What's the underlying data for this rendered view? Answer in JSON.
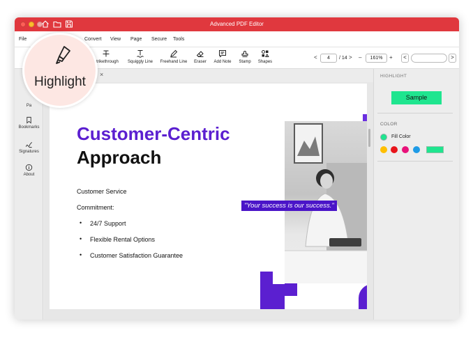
{
  "window": {
    "title": "Advanced PDF Editor"
  },
  "menu": {
    "items": [
      "File",
      "Convert",
      "View",
      "Page",
      "Secure",
      "Tools"
    ]
  },
  "toolbar": {
    "tools": [
      "Strikethrough",
      "Squiggly Line",
      "Freehand Line",
      "Eraser",
      "Add Note",
      "Stamp",
      "Shapes"
    ],
    "page_current": "4",
    "page_total": "/ 14",
    "zoom": "161%",
    "minus": "–",
    "plus": "+",
    "prev": "<",
    "next": ">"
  },
  "sidebar": {
    "items": [
      "Pa",
      "Bookmarks",
      "Signatures",
      "About"
    ]
  },
  "tab": {
    "close": "×"
  },
  "document": {
    "heading_line1": "Customer-Centric",
    "heading_line2": "Approach",
    "para1": "Customer Service",
    "para2": "Commitment:",
    "bullets": [
      "24/7 Support",
      "Flexible Rental Options",
      "Customer Satisfaction Guarantee"
    ],
    "quote": "\"Your success is our success.\""
  },
  "right_panel": {
    "title": "HIGHLIGHT",
    "sample": "Sample",
    "color_title": "COLOR",
    "fill_label": "Fill Color",
    "swatches": [
      "#ffbf00",
      "#e8141b",
      "#e8127a",
      "#1e9be6"
    ],
    "fill_color": "#1fe58f"
  },
  "callout": {
    "label": "Highlight"
  },
  "colors": {
    "accent": "#e0383e",
    "brand_purple": "#5b1fd0",
    "highlight_green": "#1fe58f"
  }
}
